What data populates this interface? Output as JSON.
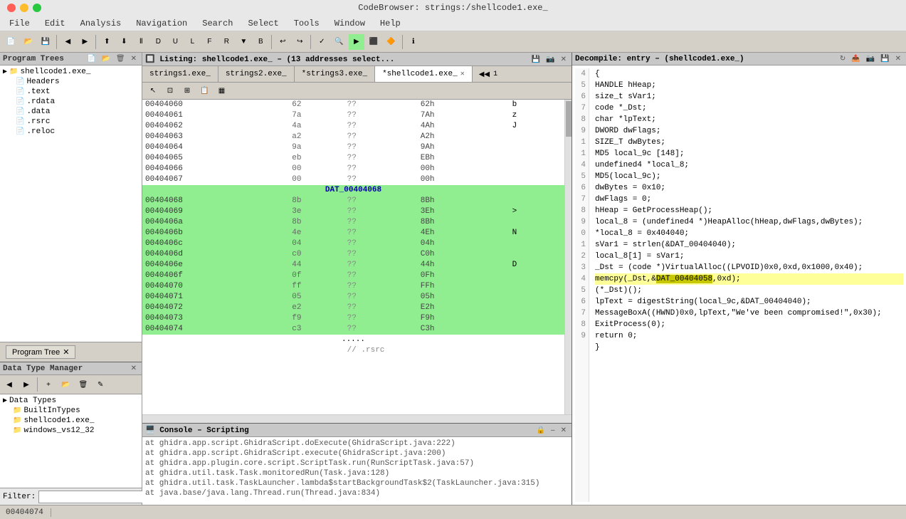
{
  "title": "CodeBrowser: strings:/shellcode1.exe_",
  "menu": [
    "File",
    "Edit",
    "Analysis",
    "Navigation",
    "Search",
    "Select",
    "Tools",
    "Window",
    "Help"
  ],
  "left_panel": {
    "program_trees_title": "Program Trees",
    "tree_items": [
      {
        "label": "shellcode1.exe_",
        "indent": 0,
        "type": "root"
      },
      {
        "label": "Headers",
        "indent": 1,
        "type": "folder"
      },
      {
        "label": ".text",
        "indent": 1,
        "type": "section"
      },
      {
        "label": ".rdata",
        "indent": 1,
        "type": "section"
      },
      {
        "label": ".data",
        "indent": 1,
        "type": "section"
      },
      {
        "label": ".rsrc",
        "indent": 1,
        "type": "section"
      },
      {
        "label": ".reloc",
        "indent": 1,
        "type": "section"
      }
    ],
    "program_tree_tab": "Program Tree",
    "data_type_manager_title": "Data Type Manager",
    "dtm_tree": [
      {
        "label": "Data Types",
        "indent": 0
      },
      {
        "label": "BuiltInTypes",
        "indent": 1
      },
      {
        "label": "shellcode1.exe_",
        "indent": 1
      },
      {
        "label": "windows_vs12_32",
        "indent": 1
      }
    ],
    "filter_label": "Filter:",
    "filter_value": ""
  },
  "listing": {
    "window_title": "Listing: shellcode1.exe_ – (13 addresses select...",
    "tabs": [
      {
        "label": "strings1.exe_",
        "active": false
      },
      {
        "label": "strings2.exe_",
        "active": false
      },
      {
        "label": "*strings3.exe_",
        "active": false,
        "modified": true
      },
      {
        "label": "*shellcode1.exe_",
        "active": true,
        "modified": true
      }
    ],
    "rows": [
      {
        "addr": "00404060",
        "b1": "62",
        "instr": "??",
        "hex": "62h",
        "char": "b"
      },
      {
        "addr": "00404061",
        "b1": "7a",
        "instr": "??",
        "hex": "7Ah",
        "char": "z"
      },
      {
        "addr": "00404062",
        "b1": "4a",
        "instr": "??",
        "hex": "4Ah",
        "char": "J"
      },
      {
        "addr": "00404063",
        "b1": "a2",
        "instr": "??",
        "hex": "A2h",
        "char": ""
      },
      {
        "addr": "00404064",
        "b1": "9a",
        "instr": "??",
        "hex": "9Ah",
        "char": ""
      },
      {
        "addr": "00404065",
        "b1": "eb",
        "instr": "??",
        "hex": "EBh",
        "char": ""
      },
      {
        "addr": "00404066",
        "b1": "00",
        "instr": "??",
        "hex": "00h",
        "char": ""
      },
      {
        "addr": "00404067",
        "b1": "00",
        "instr": "??",
        "hex": "00h",
        "char": ""
      },
      {
        "addr": "",
        "b1": "",
        "instr": "",
        "hex": "",
        "char": "",
        "label": "DAT_00404068"
      },
      {
        "addr": "00404068",
        "b1": "8b",
        "instr": "??",
        "hex": "8Bh",
        "char": "",
        "green": true
      },
      {
        "addr": "00404069",
        "b1": "3e",
        "instr": "??",
        "hex": "3Eh",
        "char": ">",
        "green": true
      },
      {
        "addr": "0040406a",
        "b1": "8b",
        "instr": "??",
        "hex": "8Bh",
        "char": "",
        "green": true
      },
      {
        "addr": "0040406b",
        "b1": "4e",
        "instr": "??",
        "hex": "4Eh",
        "char": "N",
        "green": true
      },
      {
        "addr": "0040406c",
        "b1": "04",
        "instr": "??",
        "hex": "04h",
        "char": "",
        "green": true
      },
      {
        "addr": "0040406d",
        "b1": "c0",
        "instr": "??",
        "hex": "C0h",
        "char": "",
        "green": true
      },
      {
        "addr": "0040406e",
        "b1": "44",
        "instr": "??",
        "hex": "44h",
        "char": "D",
        "green": true
      },
      {
        "addr": "0040406f",
        "b1": "0f",
        "instr": "??",
        "hex": "0Fh",
        "char": "",
        "green": true
      },
      {
        "addr": "00404070",
        "b1": "ff",
        "instr": "??",
        "hex": "FFh",
        "char": "",
        "green": true
      },
      {
        "addr": "00404071",
        "b1": "05",
        "instr": "??",
        "hex": "05h",
        "char": "",
        "green": true
      },
      {
        "addr": "00404072",
        "b1": "e2",
        "instr": "??",
        "hex": "E2h",
        "char": "",
        "green": true
      },
      {
        "addr": "00404073",
        "b1": "f9",
        "instr": "??",
        "hex": "F9h",
        "char": "",
        "green": true
      },
      {
        "addr": "00404074",
        "b1": "c3",
        "instr": "??",
        "hex": "C3h",
        "char": "",
        "green": true
      }
    ],
    "dots": ".....",
    "rsrc_comment": "// .rsrc"
  },
  "decompile": {
    "title": "Decompile: entry –  (shellcode1.exe_)",
    "lines": [
      {
        "num": "",
        "code": "{"
      },
      {
        "num": "4",
        "code": "  HANDLE hHeap;"
      },
      {
        "num": "5",
        "code": "  size_t sVar1;"
      },
      {
        "num": "6",
        "code": "  code *_Dst;"
      },
      {
        "num": "7",
        "code": "  char *lpText;"
      },
      {
        "num": "8",
        "code": "  DWORD dwFlags;"
      },
      {
        "num": "9",
        "code": "  SIZE_T dwBytes;"
      },
      {
        "num": "1",
        "code": "  MD5 local_9c [148];"
      },
      {
        "num": "1",
        "code": "  undefined4 *local_8;"
      },
      {
        "num": "",
        "code": ""
      },
      {
        "num": "4",
        "code": "  MD5(local_9c);"
      },
      {
        "num": "5",
        "code": "  dwBytes = 0x10;"
      },
      {
        "num": "6",
        "code": "  dwFlags = 0;"
      },
      {
        "num": "7",
        "code": "  hHeap = GetProcessHeap();"
      },
      {
        "num": "8",
        "code": "  local_8 = (undefined4 *)HeapAlloc(hHeap,dwFlags,dwBytes);"
      },
      {
        "num": "9",
        "code": "  *local_8 = 0x404040;"
      },
      {
        "num": "0",
        "code": "  sVar1 = strlen(&DAT_00404040);"
      },
      {
        "num": "1",
        "code": "  local_8[1] = sVar1;"
      },
      {
        "num": "2",
        "code": "  _Dst = (code *)VirtualAlloc((LPVOID)0x0,0xd,0x1000,0x40);"
      },
      {
        "num": "3",
        "code": "  memcpy(_Dst,&DAT_00404058,0xd);",
        "highlight": true
      },
      {
        "num": "4",
        "code": "  (*_Dst)();"
      },
      {
        "num": "5",
        "code": "  lpText = digestString(local_9c,&DAT_00404040);"
      },
      {
        "num": "6",
        "code": "  MessageBoxA((HWND)0x0,lpText,\"We've been compromised!\",0x30);"
      },
      {
        "num": "7",
        "code": "  ExitProcess(0);"
      },
      {
        "num": "8",
        "code": "  return 0;"
      },
      {
        "num": "9",
        "code": "}"
      }
    ]
  },
  "console": {
    "title": "Console – Scripting",
    "lines": [
      "at ghidra.app.script.GhidraScript.doExecute(GhidraScript.java:222)",
      "at ghidra.app.script.GhidraScript.execute(GhidraScript.java:200)",
      "at ghidra.app.plugin.core.script.ScriptTask.run(RunScriptTask.java:57)",
      "at ghidra.util.task.Task.monitoredRun(Task.java:128)",
      "at ghidra.util.task.TaskLauncher.lambda$startBackgroundTask$2(TaskLauncher.java:315)",
      "at java.base/java.lang.Thread.run(Thread.java:834)"
    ]
  },
  "statusbar": {
    "address": "00404074"
  }
}
